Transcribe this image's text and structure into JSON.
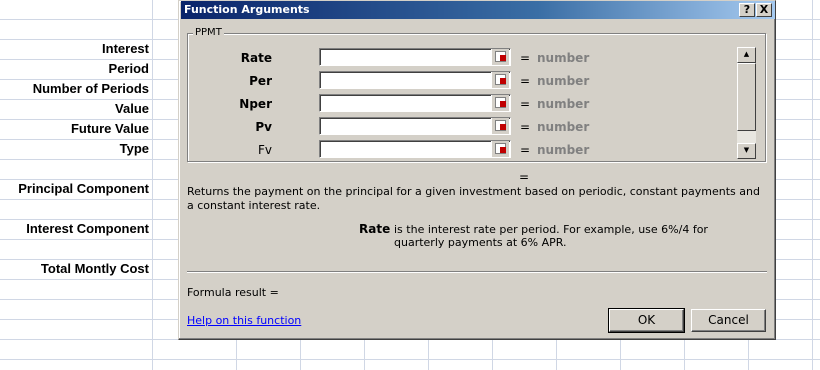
{
  "sheet": {
    "labels": [
      "Interest",
      "Period",
      "Number of Periods",
      "Value",
      "Future Value",
      "Type",
      "Principal Component",
      "Interest Component",
      "Total Montly Cost"
    ]
  },
  "dialog": {
    "title": "Function Arguments",
    "help_btn": "?",
    "close_btn": "X",
    "function_name": "PPMT",
    "args": [
      {
        "label": "Rate",
        "value": "",
        "eq": "=",
        "result": "number"
      },
      {
        "label": "Per",
        "value": "",
        "eq": "=",
        "result": "number"
      },
      {
        "label": "Nper",
        "value": "",
        "eq": "=",
        "result": "number"
      },
      {
        "label": "Pv",
        "value": "",
        "eq": "=",
        "result": "number"
      },
      {
        "label": "Fv",
        "value": "",
        "eq": "=",
        "result": "number"
      }
    ],
    "result_eq": "=",
    "description": "Returns the payment on the principal for a given investment based on periodic, constant payments and a constant interest rate.",
    "arg_help_name": "Rate",
    "arg_help_text": "is the interest rate per period. For example, use 6%/4 for quarterly payments at 6% APR.",
    "formula_result_label": "Formula result =",
    "help_link": "Help on this function",
    "ok_label": "OK",
    "cancel_label": "Cancel"
  },
  "icons": {
    "scroll_up": "scroll-up-arrow-icon",
    "scroll_down": "scroll-down-arrow-icon",
    "range_ref": "collapse-dialog-icon"
  },
  "colors": {
    "title_gradient_start": "#0a246a",
    "dialog_face": "#d4d0c8",
    "link": "#0000ff",
    "hint_text": "#808080"
  }
}
